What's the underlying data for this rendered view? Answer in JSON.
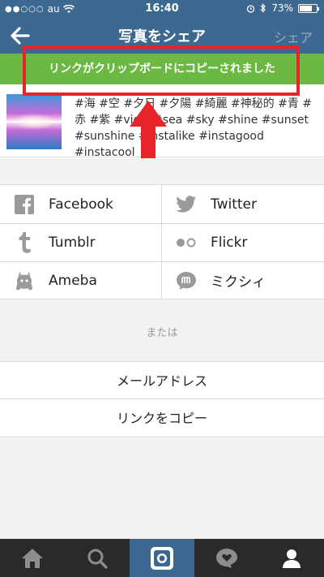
{
  "status_bar": {
    "signal": "●●○○○",
    "carrier": "au",
    "time": "16:40",
    "battery_percent": "73%",
    "battery_level": 0.73
  },
  "nav": {
    "title": "写真をシェア",
    "share_label": "シェア",
    "bar_color": "#3d6890"
  },
  "toast": {
    "text": "リンクがクリップボードにコピーされました",
    "color": "#6bb842"
  },
  "caption": {
    "text": "#海 #空 #夕日 #夕陽 #綺麗 #神秘的 #青 #赤 #紫 #view #sea #sky #shine #sunset #sunshine #instalike #instagood #instacool"
  },
  "share_options": [
    {
      "icon": "facebook-icon",
      "label": "Facebook"
    },
    {
      "icon": "twitter-icon",
      "label": "Twitter"
    },
    {
      "icon": "tumblr-icon",
      "label": "Tumblr"
    },
    {
      "icon": "flickr-icon",
      "label": "Flickr"
    },
    {
      "icon": "ameba-icon",
      "label": "Ameba"
    },
    {
      "icon": "mixi-icon",
      "label": "ミクシィ"
    }
  ],
  "or_label": "または",
  "actions": {
    "email": "メールアドレス",
    "copy_link": "リンクをコピー"
  },
  "tabbar": [
    {
      "icon": "home-icon"
    },
    {
      "icon": "search-icon"
    },
    {
      "icon": "camera-icon",
      "active": true
    },
    {
      "icon": "activity-icon"
    },
    {
      "icon": "profile-icon"
    }
  ],
  "annotation_color": "#e8232a"
}
